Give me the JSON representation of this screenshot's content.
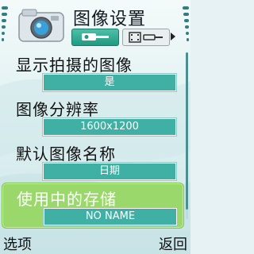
{
  "header": {
    "title": "图像设置",
    "tabs": [
      {
        "id": "general",
        "icon": "settings-tools-icon",
        "active": true
      },
      {
        "id": "video",
        "icon": "film-tools-icon",
        "active": false
      }
    ]
  },
  "settings": [
    {
      "label": "显示拍摄的图像",
      "value": "是",
      "selected": false
    },
    {
      "label": "图像分辨率",
      "value": "1600x1200",
      "selected": false
    },
    {
      "label": "默认图像名称",
      "value": "日期",
      "selected": false
    },
    {
      "label": "使用中的存储",
      "value": "NO NAME",
      "selected": true
    }
  ],
  "softkeys": {
    "left": "选项",
    "right": "返回"
  },
  "colors": {
    "value_bg": "#3fb0a3",
    "selected_bg": "#9ad86c",
    "tab_active": "#1f9a80"
  }
}
